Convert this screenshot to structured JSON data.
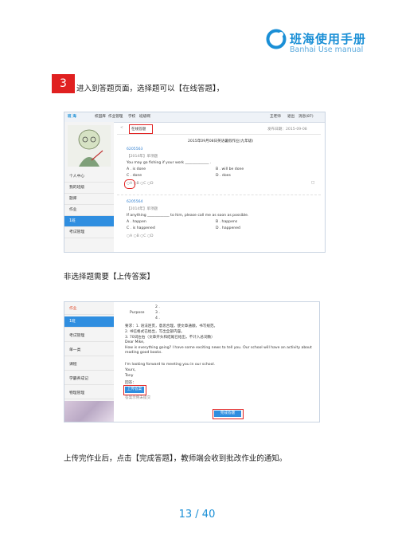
{
  "brand": {
    "title": "班海使用手册",
    "subtitle": "Banhai Use manual",
    "color": "#1a8fd6"
  },
  "step": {
    "number": "3",
    "text": "进入到答题页面，选择题可以【在线答题】，"
  },
  "shot1": {
    "topbar": [
      "班 海",
      "校园库",
      "作业管理",
      "学校",
      "班级啊",
      "王老师",
      "退出",
      "消息(87)"
    ],
    "breadcrumb": "在线答题",
    "date": "发布日期：2015-09-08",
    "heading": "2015年09月08日英语暑假作业(九年级)",
    "sidebar": [
      "个人中心",
      "我的班级",
      "题库",
      "作业",
      "1班",
      "考试管理"
    ],
    "q1": {
      "id": "6205563",
      "meta": "【2014年】单项题",
      "stem": "You may go fishing if your work _____________ .",
      "options": [
        "A . is done",
        "B . will be done",
        "C . done",
        "D . does"
      ],
      "choices": [
        "A",
        "B",
        "C",
        "D"
      ]
    },
    "q2": {
      "id": "6205564",
      "meta": "【2014年】单项题",
      "stem": "If anything ____________ to him, please call me as soon as possible.",
      "options": [
        "A . happen",
        "B . happens",
        "C . is happened",
        "D . happened"
      ],
      "choices": [
        "A",
        "B",
        "C",
        "D"
      ]
    }
  },
  "caption1": "非选择题需要【上传答案】",
  "shot2": {
    "sidebar": [
      "作业",
      "1班",
      "考试管理",
      "单一类",
      "课程",
      "学霸养成记",
      "物理管理"
    ],
    "purpose_label": "Purpose",
    "list_numbers": [
      "2 .",
      "3 .",
      "4 ."
    ],
    "requirements": [
      "要求：1. 语法连贯，意思合理，使文章通顺，书写规范。",
      "2. 书信格式已给出，写出全部内容。",
      "3. 70词左右（文章开头和结尾已给出，不计入总词数）"
    ],
    "letter": [
      "Dear Mike,",
      "How is everything going? I have some exciting news to tell you. Our school will have an activity about reading good books.",
      "I'm looking forward to meeting you in our school.",
      "Yours,",
      "Tony"
    ],
    "answer_label": "回答：",
    "upload_button": "上传答案",
    "note": "答案示例未提交",
    "submit_button": "完成答题"
  },
  "caption2": "上传完作业后，点击【完成答题】，教师端会收到批改作业的通知。",
  "page": "13 / 40"
}
